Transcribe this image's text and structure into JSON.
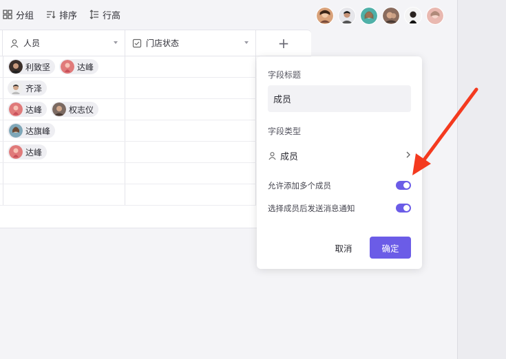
{
  "toolbar": {
    "group_label": "分组",
    "sort_label": "排序",
    "rowheight_label": "行高",
    "group_icon": "grid-icon",
    "sort_icon": "sort-icon",
    "rowheight_icon": "row-height-icon"
  },
  "collaborators": [
    "avatar-1",
    "avatar-2",
    "avatar-3",
    "avatar-4",
    "avatar-5",
    "avatar-6"
  ],
  "table": {
    "columns": [
      {
        "label": "人员",
        "icon": "person-icon"
      },
      {
        "label": "门店状态",
        "icon": "checkbox-icon"
      }
    ],
    "add_column_symbol": "+",
    "rows": [
      {
        "members": [
          "利致坚",
          "达峰"
        ]
      },
      {
        "members": [
          "齐泽"
        ]
      },
      {
        "members": [
          "达峰",
          "权志仪"
        ]
      },
      {
        "members": [
          "达旗峰"
        ]
      },
      {
        "members": [
          "达峰"
        ]
      },
      {
        "members": []
      },
      {
        "members": []
      }
    ]
  },
  "field_panel": {
    "title_label": "字段标题",
    "title_value": "成员",
    "type_label": "字段类型",
    "type_value": "成员",
    "type_icon": "person-icon",
    "toggles": [
      {
        "label": "允许添加多个成员",
        "on": true
      },
      {
        "label": "选择成员后发送消息通知",
        "on": true
      }
    ],
    "cancel_label": "取消",
    "confirm_label": "确定"
  },
  "colors": {
    "accent": "#6b5ce7",
    "annotation_arrow": "#f43a1f"
  }
}
